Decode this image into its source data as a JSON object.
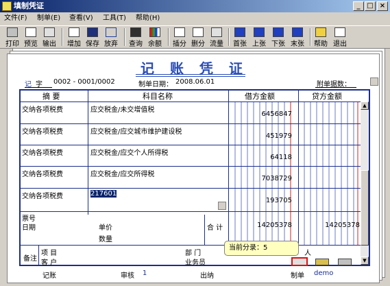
{
  "window": {
    "title": "填制凭证"
  },
  "menu": [
    "文件(F)",
    "制单(E)",
    "查看(V)",
    "工具(T)",
    "帮助(H)"
  ],
  "toolbar": [
    {
      "label": "打印",
      "icon": "print-icon"
    },
    {
      "label": "预览",
      "icon": "preview-icon"
    },
    {
      "label": "输出",
      "icon": "export-icon"
    },
    {
      "label": "增加",
      "icon": "add-icon"
    },
    {
      "label": "保存",
      "icon": "save-icon"
    },
    {
      "label": "放弃",
      "icon": "undo-icon"
    },
    {
      "label": "查询",
      "icon": "binoculars-icon"
    },
    {
      "label": "余额",
      "icon": "balance-chart-icon"
    },
    {
      "label": "插分",
      "icon": "insert-row-icon"
    },
    {
      "label": "删分",
      "icon": "delete-row-icon"
    },
    {
      "label": "流量",
      "icon": "cashflow-icon"
    },
    {
      "label": "首张",
      "icon": "first-icon"
    },
    {
      "label": "上张",
      "icon": "prev-icon"
    },
    {
      "label": "下张",
      "icon": "next-icon"
    },
    {
      "label": "末张",
      "icon": "last-icon"
    },
    {
      "label": "帮助",
      "icon": "help-icon"
    },
    {
      "label": "退出",
      "icon": "exit-icon"
    }
  ],
  "voucher": {
    "title": "记 账 凭 证",
    "type_label": "记",
    "type_char": "字",
    "number": "0002 - 0001/0002",
    "date_label": "制单日期：",
    "date": "2008.06.01",
    "attach_label": "附单据数：",
    "col_summary": "摘 要",
    "col_account": "科目名称",
    "col_debit": "借方金额",
    "col_credit": "贷方金额",
    "rows": [
      {
        "summary": "交纳各项税费",
        "account": "应交税金/未交增值税",
        "debit": "6456847"
      },
      {
        "summary": "交纳各项税费",
        "account": "应交税金/应交城市维护建设税",
        "debit": "451979"
      },
      {
        "summary": "交纳各项税费",
        "account": "应交税金/应交个人所得税",
        "debit": "64118"
      },
      {
        "summary": "交纳各项税费",
        "account": "应交税金/应交所得税",
        "debit": "7038729"
      },
      {
        "summary": "交纳各项税费",
        "account": "217601",
        "debit": "193705"
      }
    ],
    "ticket_label": "票号",
    "date_row_label": "日期",
    "price_label": "单价",
    "qty_label": "数量",
    "total_label": "合 计",
    "total_debit": "14205378",
    "total_credit": "14205378",
    "remark_label": "备注",
    "project_label": "项 目",
    "dept_label": "部 门",
    "person_label": "人",
    "customer_label": "客 户",
    "clerk_label": "业务员"
  },
  "tooltip": "当前分录：5",
  "footer": {
    "post_label": "记账",
    "audit_label": "审核",
    "audit_value": "1",
    "cashier_label": "出纳",
    "maker_label": "制单",
    "maker_value": "demo"
  },
  "colors": {
    "accent": "#1a2e8a",
    "title": "#2a4db8",
    "red_line": "#d02020"
  }
}
